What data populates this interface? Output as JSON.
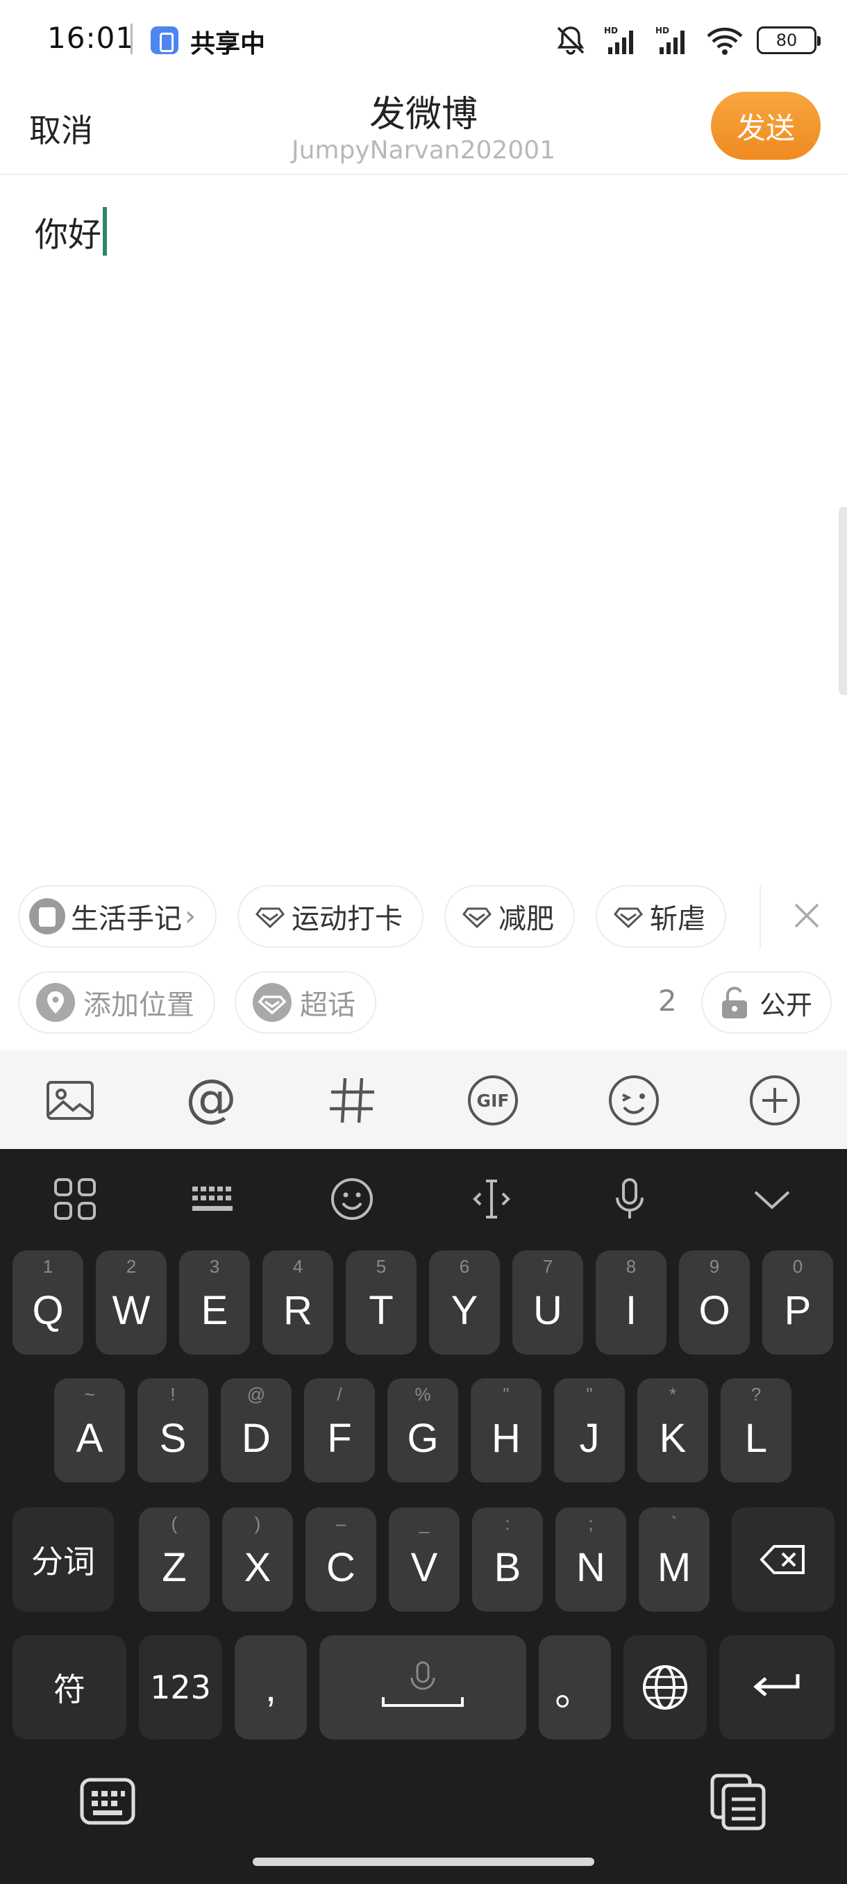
{
  "status_bar": {
    "time": "16:01",
    "share_label": "共享中",
    "battery": "80"
  },
  "header": {
    "cancel": "取消",
    "title": "发微博",
    "username": "JumpyNarvan202001",
    "send": "发送"
  },
  "editor": {
    "text": "你好"
  },
  "topics": {
    "items": [
      "生活手记",
      "运动打卡",
      "减肥",
      "斩虐"
    ]
  },
  "location": {
    "add_location": "添加位置",
    "super_topic": "超话",
    "char_count": "2",
    "visibility": "公开"
  },
  "colors": {
    "accent": "#f08a21",
    "caret": "#2d8a63",
    "keyboard_bg": "#1e1e1e",
    "key_bg": "#3a3a3a"
  },
  "keyboard": {
    "row1": [
      {
        "hint": "1",
        "key": "Q"
      },
      {
        "hint": "2",
        "key": "W"
      },
      {
        "hint": "3",
        "key": "E"
      },
      {
        "hint": "4",
        "key": "R"
      },
      {
        "hint": "5",
        "key": "T"
      },
      {
        "hint": "6",
        "key": "Y"
      },
      {
        "hint": "7",
        "key": "U"
      },
      {
        "hint": "8",
        "key": "I"
      },
      {
        "hint": "9",
        "key": "O"
      },
      {
        "hint": "0",
        "key": "P"
      }
    ],
    "row2": [
      {
        "hint": "~",
        "key": "A"
      },
      {
        "hint": "!",
        "key": "S"
      },
      {
        "hint": "@",
        "key": "D"
      },
      {
        "hint": "/",
        "key": "F"
      },
      {
        "hint": "%",
        "key": "G"
      },
      {
        "hint": "\"",
        "key": "H"
      },
      {
        "hint": "\"",
        "key": "J"
      },
      {
        "hint": "*",
        "key": "K"
      },
      {
        "hint": "?",
        "key": "L"
      }
    ],
    "row3": [
      {
        "hint": "(",
        "key": "Z"
      },
      {
        "hint": ")",
        "key": "X"
      },
      {
        "hint": "–",
        "key": "C"
      },
      {
        "hint": "_",
        "key": "V"
      },
      {
        "hint": ":",
        "key": "B"
      },
      {
        "hint": ";",
        "key": "N"
      },
      {
        "hint": "`",
        "key": "M"
      }
    ],
    "segment_key": "分词",
    "symbol_key": "符",
    "number_key": "123",
    "comma_key": ",",
    "period_key": "。"
  }
}
